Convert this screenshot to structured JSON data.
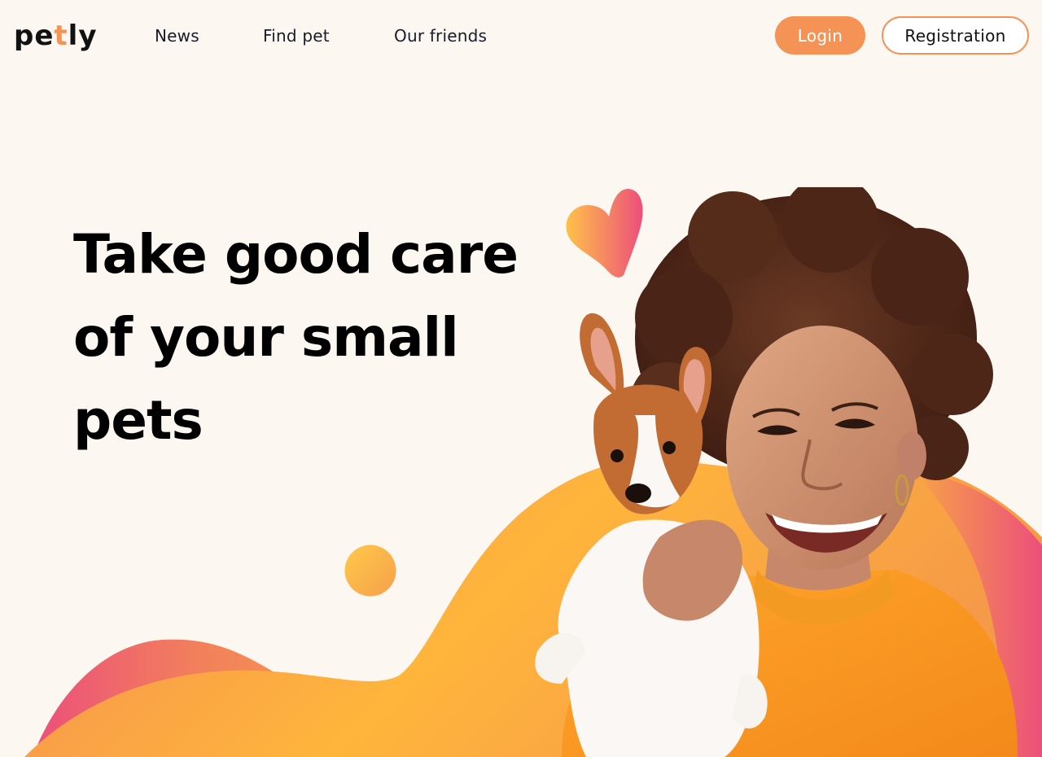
{
  "header": {
    "logo": {
      "part1": "pe",
      "part2": "t",
      "part3": "ly"
    },
    "nav": [
      {
        "label": "News"
      },
      {
        "label": "Find pet"
      },
      {
        "label": "Our friends"
      }
    ],
    "auth": {
      "login_label": "Login",
      "register_label": "Registration"
    }
  },
  "hero": {
    "title_lines": [
      "Take good care",
      "of your small",
      "pets"
    ],
    "photo": "woman-hugging-puppy"
  },
  "colors": {
    "background": "#FDF7F2",
    "accent": "#F59256",
    "gradient_start": "#FFC149",
    "gradient_end": "#EC4F7B",
    "text": "#111111"
  },
  "icons": {
    "heart": "heart-icon",
    "circle": "circle-decoration"
  }
}
